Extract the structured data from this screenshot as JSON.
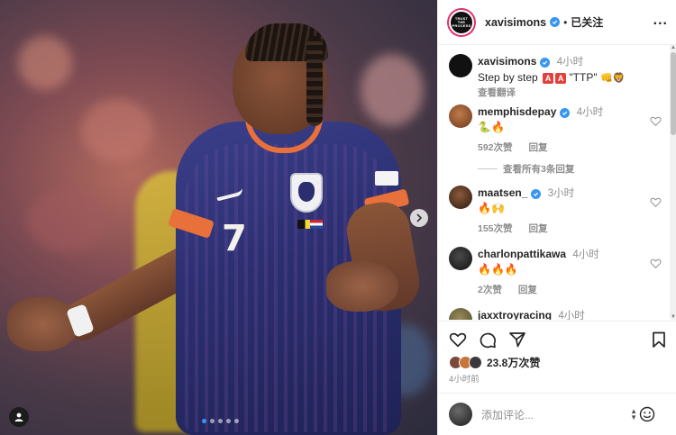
{
  "post": {
    "username": "xavisimons",
    "follow_status": "已关注",
    "header_dot": "•",
    "more": "...",
    "avatar_text": "TRUST THE PROCESS",
    "caption": {
      "username": "xavisimons",
      "time": "4小时",
      "text": "Step by step",
      "aa1": "A",
      "aa2": "A",
      "quote": "\"TTP\"",
      "emojis": "👊🦁",
      "translate": "查看翻译"
    },
    "likes": "23.8万次赞",
    "posted_ago": "4小时前",
    "add_comment_placeholder": "添加评论..."
  },
  "comments": [
    {
      "username": "memphisdepay",
      "verified": true,
      "time": "4小时",
      "text": "🐍🔥",
      "likes": "592次赞",
      "reply": "回复",
      "view_replies": "查看所有3条回复"
    },
    {
      "username": "maatsen_",
      "verified": true,
      "time": "3小时",
      "text": "🔥🙌",
      "likes": "155次赞",
      "reply": "回复"
    },
    {
      "username": "charlonpattikawa",
      "verified": false,
      "time": "4小时",
      "text": "🔥🔥🔥",
      "likes": "2次赞",
      "reply": "回复"
    },
    {
      "username": "jaxxtroyracing",
      "verified": false,
      "time": "4小时"
    }
  ],
  "icons": {
    "like": "heart-icon",
    "comment": "comment-icon",
    "share": "share-icon",
    "save": "bookmark-icon",
    "emoji": "emoji-icon",
    "next": "chevron-right-icon",
    "tag": "user-tag-icon"
  },
  "colors": {
    "verified": "#3897f0",
    "muted": "#8e8e8e",
    "text": "#262626",
    "story_ring": "#e1306c"
  }
}
